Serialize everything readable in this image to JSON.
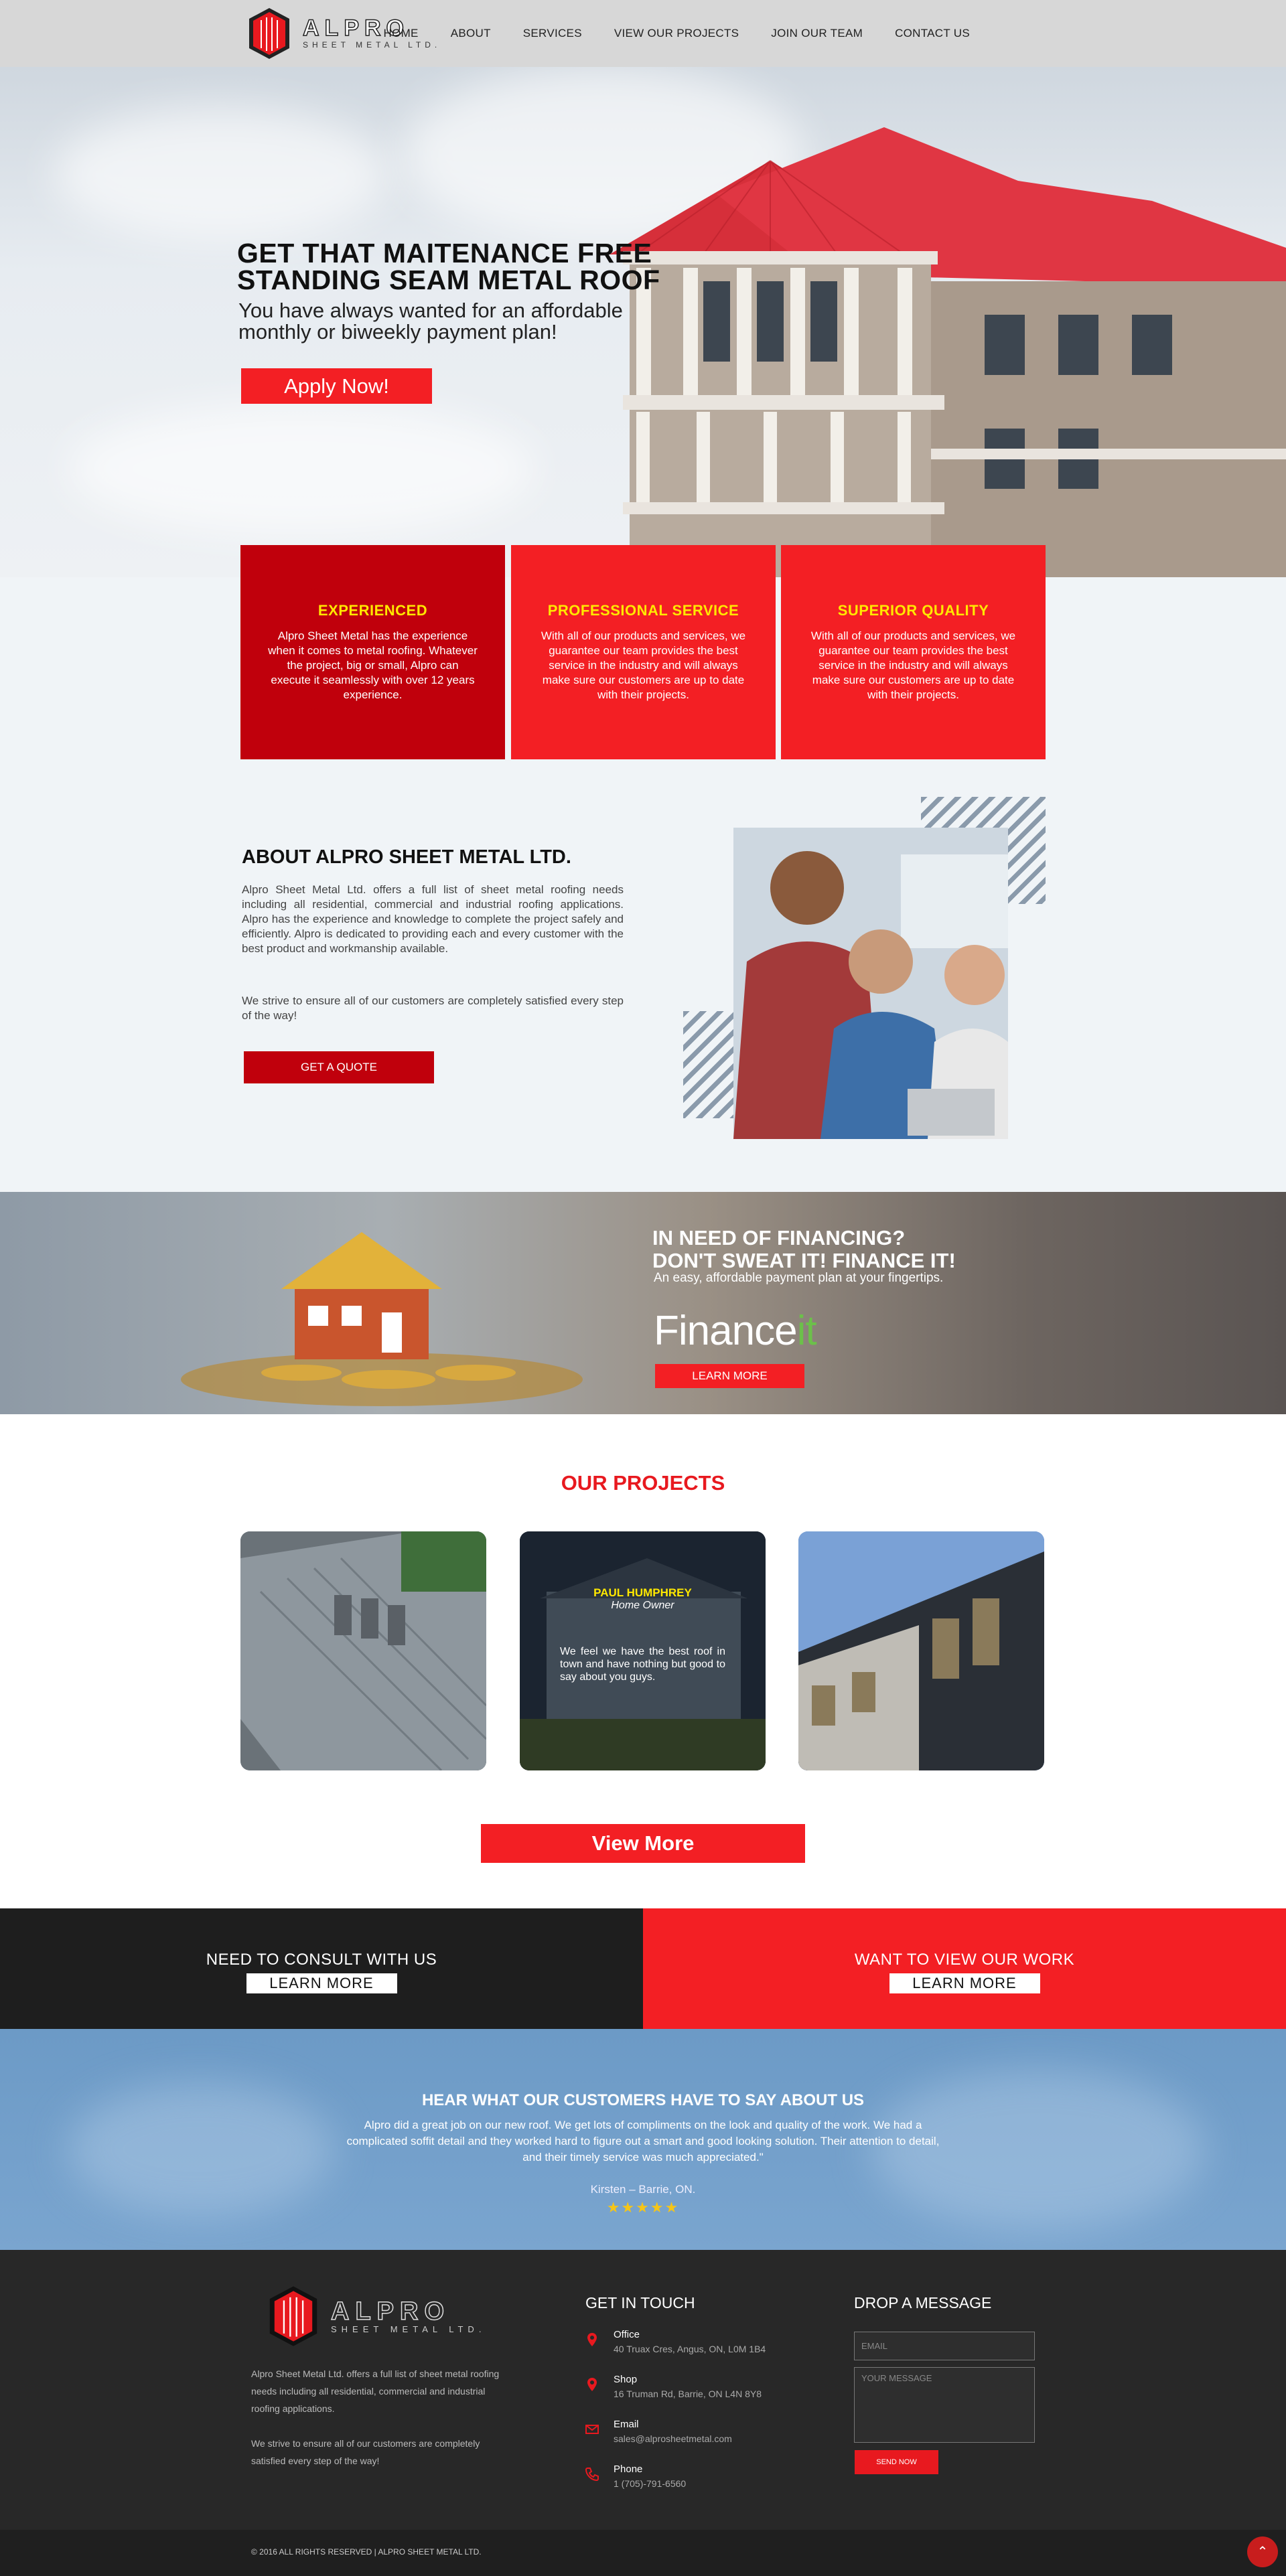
{
  "header": {
    "logo_text": "ALPRO",
    "logo_subtext": "SHEET METAL LTD.",
    "nav": [
      "HOME",
      "ABOUT",
      "SERVICES",
      "VIEW OUR PROJECTS",
      "JOIN OUR TEAM",
      "CONTACT US"
    ]
  },
  "hero": {
    "title": "GET THAT MAITENANCE FREE STANDING SEAM METAL ROOF",
    "subtitle": "You have always wanted for an affordable monthly or biweekly payment plan!",
    "cta": "Apply Now!"
  },
  "features": [
    {
      "title": "EXPERIENCED",
      "text": "Alpro Sheet Metal has the experience when it comes to metal roofing. Whatever the project, big or small, Alpro can execute it seamlessly with over 12 years experience.",
      "color": "#c0000c"
    },
    {
      "title": "PROFESSIONAL SERVICE",
      "text": "With all of our products and services, we guarantee our team provides the best service in the industry and will always make sure our customers are up to date with their projects.",
      "color": "#f31f24"
    },
    {
      "title": "SUPERIOR QUALITY",
      "text": "With all of our products and services, we guarantee our team provides the best service in the industry and will always make sure our customers are up to date with their projects.",
      "color": "#f31f24"
    }
  ],
  "about": {
    "title": "ABOUT ALPRO SHEET METAL LTD.",
    "p1": "Alpro Sheet Metal Ltd. offers a full list of sheet metal roofing needs including all residential, commercial and industrial roofing applications. Alpro has the experience and knowledge to complete the project safely and efficiently. Alpro is dedicated to providing each and every customer with the best product and workmanship available.",
    "p2": "We strive to ensure all of our customers are completely satisfied every step of the way!",
    "cta": "GET A QUOTE"
  },
  "finance": {
    "title_line1": "IN NEED OF FINANCING?",
    "title_line2": "DON'T SWEAT IT! FINANCE IT!",
    "subtitle": "An easy, affordable payment plan at your fingertips.",
    "logo_main": "Finance",
    "logo_accent": "it",
    "cta": "LEARN MORE"
  },
  "projects": {
    "title": "OUR PROJECTS",
    "testimonial_name": "PAUL HUMPHREY",
    "testimonial_role": "Home Owner",
    "testimonial_text": "We feel we have the best roof in town and have nothing but good to say about you guys.",
    "cta": "View More"
  },
  "consult": {
    "left_title": "NEED TO CONSULT WITH US",
    "left_cta": "LEARN MORE",
    "right_title": "WANT TO VIEW OUR WORK",
    "right_cta": "LEARN MORE"
  },
  "testimonials": {
    "title": "HEAR WHAT OUR CUSTOMERS HAVE TO SAY ABOUT US",
    "quote": "Alpro did a great job on our new roof. We get lots of compliments on the look and quality of the work. We had a complicated soffit detail and they worked hard to figure out a smart and good looking solution. Their attention to detail, and their timely service was much appreciated.\"",
    "author": "Kirsten – Barrie, ON.",
    "stars": "★★★★★"
  },
  "footer": {
    "desc1": "Alpro Sheet Metal Ltd. offers a full list of sheet metal roofing needs including all residential, commercial and industrial roofing applications.",
    "desc2": "We strive to ensure all of our customers are completely satisfied every step of the way!",
    "contact_title": "GET IN TOUCH",
    "office_label": "Office",
    "office_value": "40 Truax Cres, Angus, ON, L0M 1B4",
    "shop_label": "Shop",
    "shop_value": "16 Truman Rd, Barrie, ON L4N 8Y8",
    "email_label": "Email",
    "email_value": "sales@alprosheetmetal.com",
    "phone_label": "Phone",
    "phone_value": "1 (705)-791-6560",
    "message_title": "DROP A MESSAGE",
    "email_placeholder": "EMAIL",
    "message_placeholder": "YOUR MESSAGE",
    "send": "SEND NOW",
    "copyright": "© 2016 ALL RIGHTS RESERVED | ALPRO SHEET METAL LTD."
  },
  "colors": {
    "brand_red": "#f31f24",
    "dark_red": "#c0000c",
    "yellow": "#ffe800",
    "dark": "#1e1e1e"
  }
}
